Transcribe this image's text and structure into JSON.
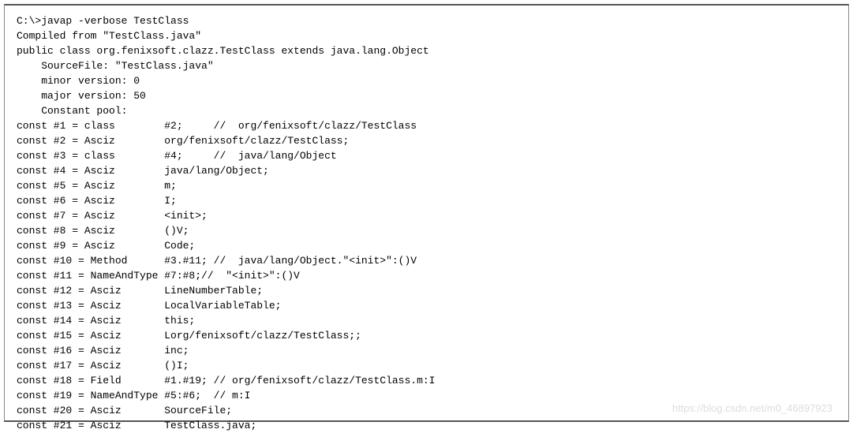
{
  "lines": [
    "C:\\>javap -verbose TestClass",
    "Compiled from \"TestClass.java\"",
    "public class org.fenixsoft.clazz.TestClass extends java.lang.Object",
    "    SourceFile: \"TestClass.java\"",
    "    minor version: 0",
    "    major version: 50",
    "    Constant pool:",
    "const #1 = class        #2;     //  org/fenixsoft/clazz/TestClass",
    "const #2 = Asciz        org/fenixsoft/clazz/TestClass;",
    "const #3 = class        #4;     //  java/lang/Object",
    "const #4 = Asciz        java/lang/Object;",
    "const #5 = Asciz        m;",
    "const #6 = Asciz        I;",
    "const #7 = Asciz        <init>;",
    "const #8 = Asciz        ()V;",
    "const #9 = Asciz        Code;",
    "const #10 = Method      #3.#11; //  java/lang/Object.\"<init>\":()V",
    "const #11 = NameAndType #7:#8;//  \"<init>\":()V",
    "const #12 = Asciz       LineNumberTable;",
    "const #13 = Asciz       LocalVariableTable;",
    "const #14 = Asciz       this;",
    "const #15 = Asciz       Lorg/fenixsoft/clazz/TestClass;;",
    "const #16 = Asciz       inc;",
    "const #17 = Asciz       ()I;",
    "const #18 = Field       #1.#19; // org/fenixsoft/clazz/TestClass.m:I",
    "const #19 = NameAndType #5:#6;  // m:I",
    "const #20 = Asciz       SourceFile;",
    "const #21 = Asciz       TestClass.java;"
  ],
  "watermark": "https://blog.csdn.net/m0_46897923"
}
